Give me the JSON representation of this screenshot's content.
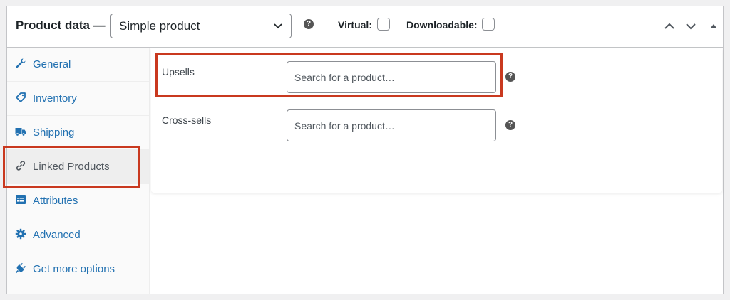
{
  "header": {
    "title": "Product data —",
    "product_type": "Simple product",
    "virtual_label": "Virtual:",
    "downloadable_label": "Downloadable:",
    "help_glyph": "?"
  },
  "tabs": [
    {
      "label": "General",
      "icon": "wrench-icon"
    },
    {
      "label": "Inventory",
      "icon": "tag-icon"
    },
    {
      "label": "Shipping",
      "icon": "truck-icon"
    },
    {
      "label": "Linked Products",
      "icon": "link-icon",
      "active": true
    },
    {
      "label": "Attributes",
      "icon": "list-icon"
    },
    {
      "label": "Advanced",
      "icon": "gear-icon"
    },
    {
      "label": "Get more options",
      "icon": "plug-icon"
    }
  ],
  "fields": {
    "upsells": {
      "label": "Upsells",
      "placeholder": "Search for a product…"
    },
    "crosssells": {
      "label": "Cross-sells",
      "placeholder": "Search for a product…"
    }
  },
  "colors": {
    "link": "#2271b1",
    "highlight": "#c9391f",
    "border": "#c3c4c7"
  }
}
